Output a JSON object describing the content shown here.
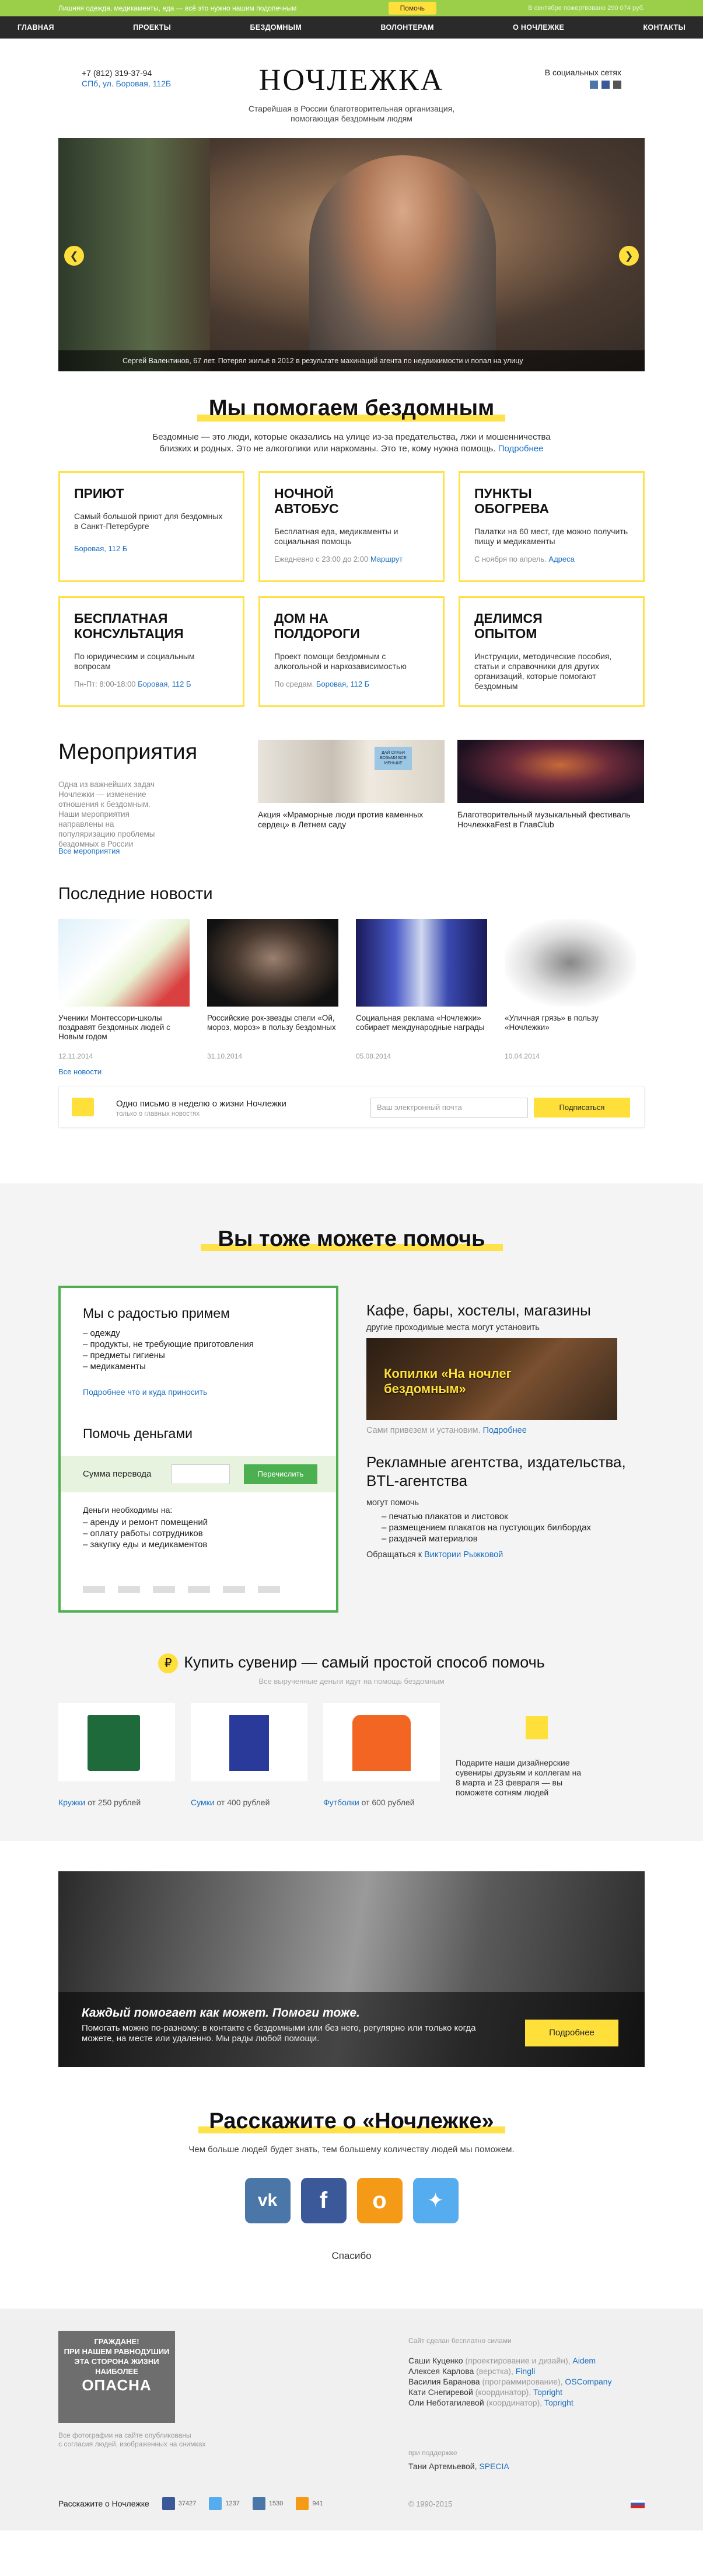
{
  "topstrip": {
    "text": "Лишняя одежда, медикаменты, еда — всё это нужно нашим подопечным",
    "help_button": "Помочь",
    "stat": "В сентябре пожертвовано 290 074 руб."
  },
  "nav": [
    "ГЛАВНАЯ",
    "ПРОЕКТЫ",
    "БЕЗДОМНЫМ",
    "ВОЛОНТЕРАМ",
    "О НОЧЛЕЖКЕ",
    "КОНТАКТЫ"
  ],
  "header": {
    "phone": "+7 (812) 319-37-94",
    "address": "СПб, ул. Боровая, 112Б",
    "logo": "НОЧЛЕЖКА",
    "tagline_1": "Старейшая в России благотворительная организация,",
    "tagline_2": "помогающая бездомным людям",
    "social_label": "В социальных сетях"
  },
  "hero": {
    "caption": "Сергей Валентинов, 67 лет. Потерял жильё в 2012 в результате махинаций агента по недвижимости и попал на улицу"
  },
  "help": {
    "title": "Мы помогаем бездомным",
    "intro_1": "Бездомные — это люди, которые оказались на улице из-за предательства, лжи и мошенничества",
    "intro_2": "близких и родных. Это не алкоголики или наркоманы. Это те, кому нужна помощь.",
    "intro_link": "Подробнее",
    "cards": [
      {
        "title": "ПРИЮТ",
        "text": "Самый большой приют для бездомных в Санкт-Петербурге",
        "foot": "",
        "link": "Боровая, 112 Б"
      },
      {
        "title": "НОЧНОЙ АВТОБУС",
        "text": "Бесплатная еда, медикаменты и социальная помощь",
        "foot": "Ежедневно с 23:00 до 2:00",
        "link": "Маршрут"
      },
      {
        "title": "ПУНКТЫ ОБОГРЕВА",
        "text": "Палатки на 60 мест, где можно получить пищу и медикаменты",
        "foot": "С ноября по апрель.",
        "link": "Адреса"
      },
      {
        "title": "БЕСПЛАТНАЯ КОНСУЛЬТАЦИЯ",
        "text": "По юридическим и социальным вопросам",
        "foot": "Пн-Пт: 8:00-18:00",
        "link": "Боровая, 112 Б"
      },
      {
        "title": "ДОМ НА ПОЛДОРОГИ",
        "text": "Проект помощи бездомным с алкогольной и наркозависимостью",
        "foot": "По средам.",
        "link": "Боровая, 112 Б"
      },
      {
        "title": "ДЕЛИМСЯ ОПЫТОМ",
        "text": "Инструкции, методические пособия, статьи и справочники для других организаций, которые помогают бездомным",
        "foot": "",
        "link": ""
      }
    ]
  },
  "events": {
    "title": "Мероприятия",
    "desc": "Одна из важнейших задач Ночлежки — изменение отношения к бездомным. Наши мероприятия направлены на популяризацию проблемы бездомных в России",
    "all_link": "Все мероприятия",
    "items": [
      {
        "text": "Акция «Мраморные люди против каменных сердец» в Летнем саду",
        "sign": "ДАЙ СЛАБИ ВОЗЬМИ ВСЕ МЕНЬШЕ"
      },
      {
        "text": "Благотворительный музыкальный фестиваль НочлежкаFest в ГлавClub",
        "sign": ""
      }
    ]
  },
  "news": {
    "title": "Последние новости",
    "all_link": "Все новости",
    "items": [
      {
        "text": "Ученики Монтессори-школы поздравят бездомных людей с Новым годом",
        "date": "12.11.2014"
      },
      {
        "text": "Российские рок-звезды спели «Ой, мороз, мороз» в пользу бездомных",
        "date": "31.10.2014"
      },
      {
        "text": "Социальная реклама «Ночлежки» собирает международные награды",
        "date": "05.08.2014"
      },
      {
        "text": "«Уличная грязь» в пользу «Ночлежки»",
        "date": "10.04.2014"
      }
    ]
  },
  "subscribe": {
    "title": "Одно письмо в неделю о жизни Ночлежки",
    "sub": "только о главных новостях",
    "placeholder": "Ваш электронный почта",
    "button": "Подписаться"
  },
  "can_help": {
    "title": "Вы тоже можете помочь",
    "accept_title": "Мы с радостью примем",
    "accept_items": [
      "одежду",
      "продукты, не требующие приготовления",
      "предметы гигиены",
      "медикаменты"
    ],
    "accept_link": "Подробнее что и куда приносить",
    "money_title": "Помочь деньгами",
    "amount_label": "Сумма перевода",
    "transfer_button": "Перечислить",
    "needs_title": "Деньги необходимы на:",
    "needs_items": [
      "аренду и ремонт помещений",
      "оплату работы сотрудников",
      "закупку еды и медикаментов"
    ],
    "cafe_title": "Кафе, бары, хостелы, магазины",
    "cafe_sub": "другие проходимые места могут установить",
    "kopilki": "Копилки «На ночлег бездомным»",
    "kopilki_note": "Сами привезем и установим.",
    "kopilki_link": "Подробнее",
    "agency_title": "Рекламные агентства, издательства, BTL-агентства",
    "agency_sub": "могут помочь",
    "agency_items": [
      "печатью плакатов и листовок",
      "размещением плакатов на пустующих билбордах",
      "раздачей материалов"
    ],
    "contact_text": "Обращаться к",
    "contact_link": "Виктории Рыжковой"
  },
  "souvenirs": {
    "title": "Купить сувенир — самый простой способ помочь",
    "sub": "Все вырученные деньги идут на помощь бездомным",
    "items": [
      {
        "link": "Кружки",
        "price": "от 250 рублей"
      },
      {
        "link": "Сумки",
        "price": "от 400 рублей"
      },
      {
        "link": "Футболки",
        "price": "от 600 рублей"
      }
    ],
    "gift_text": "Подарите наши дизайнерские сувениры друзьям и коллегам на 8 марта и 23 февраля — вы поможете сотням людей"
  },
  "banner": {
    "title": "Каждый помогает как может. Помоги тоже.",
    "text": "Помогать можно по-разному: в контакте с бездомными или без него, регулярно или только когда можете, на месте или удаленно. Мы рады любой помощи.",
    "button": "Подробнее"
  },
  "share": {
    "title": "Расскажите о «Ночлежке»",
    "sub": "Чем больше людей будет знать, тем большему количеству людей мы поможем.",
    "thanks": "Спасибо"
  },
  "footer": {
    "poster_1": "ГРАЖДАНЕ!",
    "poster_2": "ПРИ НАШЕМ РАВНОДУШИИ",
    "poster_3": "ЭТА СТОРОНА ЖИЗНИ",
    "poster_4": "НАИБОЛЕЕ",
    "poster_5": "ОПАСНА",
    "photos_note_1": "Все фотографии на сайте опубликованы",
    "photos_note_2": "с согласия людей, изображенных на снимках",
    "made_label": "Сайт сделан бесплатно силами",
    "credits": [
      {
        "name": "Саши Куценко",
        "role": "(проектирование и дизайн),",
        "link": "Aidem"
      },
      {
        "name": "Алексея Карлова",
        "role": "(верстка),",
        "link": "Fingli"
      },
      {
        "name": "Василия Баранова",
        "role": "(программирование),",
        "link": "OSCompany"
      },
      {
        "name": "Кати Снегиревой",
        "role": "(координатор),",
        "link": "Topright"
      },
      {
        "name": "Оли Неботагилевой",
        "role": "(координатор),",
        "link": "Topright"
      }
    ],
    "assist_label": "при поддержке",
    "assist_name": "Тани Артемьевой,",
    "assist_link": "SPECIA",
    "share_label": "Расскажите о Ночлежке",
    "counts": {
      "fb": "37427",
      "tw": "1237",
      "vk": "1530",
      "ok": "941"
    },
    "copyright": "© 1990-2015"
  },
  "colors": {
    "yellow": "#ffdf3a",
    "green": "#4caf50",
    "link": "#1a6fc0",
    "vk": "#4a76a8",
    "fb": "#3b5998",
    "ok": "#f59a16",
    "tw": "#55acee"
  }
}
